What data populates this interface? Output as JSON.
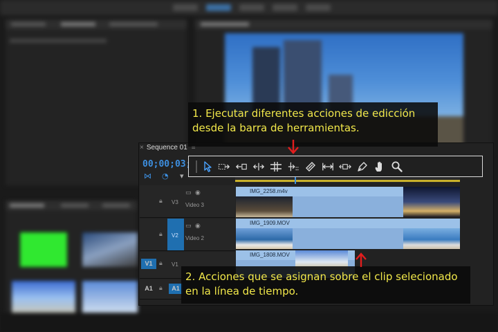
{
  "sequence": {
    "tab_label": "Sequence 01",
    "timecode": "00;00;03;2"
  },
  "callouts": {
    "toolbar_note": [
      "1. Ejecutar diferentes acciones de edicción",
      "desde la barra de herramientas."
    ],
    "timeline_note": [
      "2. Acciones que se asignan sobre el clip selecionado",
      "en la línea de tiempo."
    ]
  },
  "toolbar": {
    "tools": [
      {
        "name": "selection-tool-icon"
      },
      {
        "name": "track-select-forward-icon"
      },
      {
        "name": "ripple-edit-icon"
      },
      {
        "name": "rolling-edit-icon"
      },
      {
        "name": "rate-stretch-icon"
      },
      {
        "name": "razor-icon"
      },
      {
        "name": "slip-icon"
      },
      {
        "name": "slide-icon"
      },
      {
        "name": "pen-icon"
      },
      {
        "name": "hand-icon"
      },
      {
        "name": "zoom-icon"
      }
    ]
  },
  "tracks": [
    {
      "target": "",
      "label": "V3",
      "name": "Video 3",
      "clip": "IMG_2258.m4v"
    },
    {
      "target": "",
      "label": "V2",
      "name": "Video 2",
      "clip": "IMG_1909.MOV"
    },
    {
      "target": "V1",
      "label": "V1",
      "name": "",
      "clip": "IMG_1808.MOV"
    },
    {
      "target": "A1",
      "label": "A1",
      "name": "",
      "clip": ""
    }
  ],
  "colors": {
    "callout_text": "#f2e84a",
    "arrow": "#e21d1d",
    "clip": "#8ab0dc",
    "timecode": "#3d8fe0",
    "track_target": "#1f6fb0"
  }
}
